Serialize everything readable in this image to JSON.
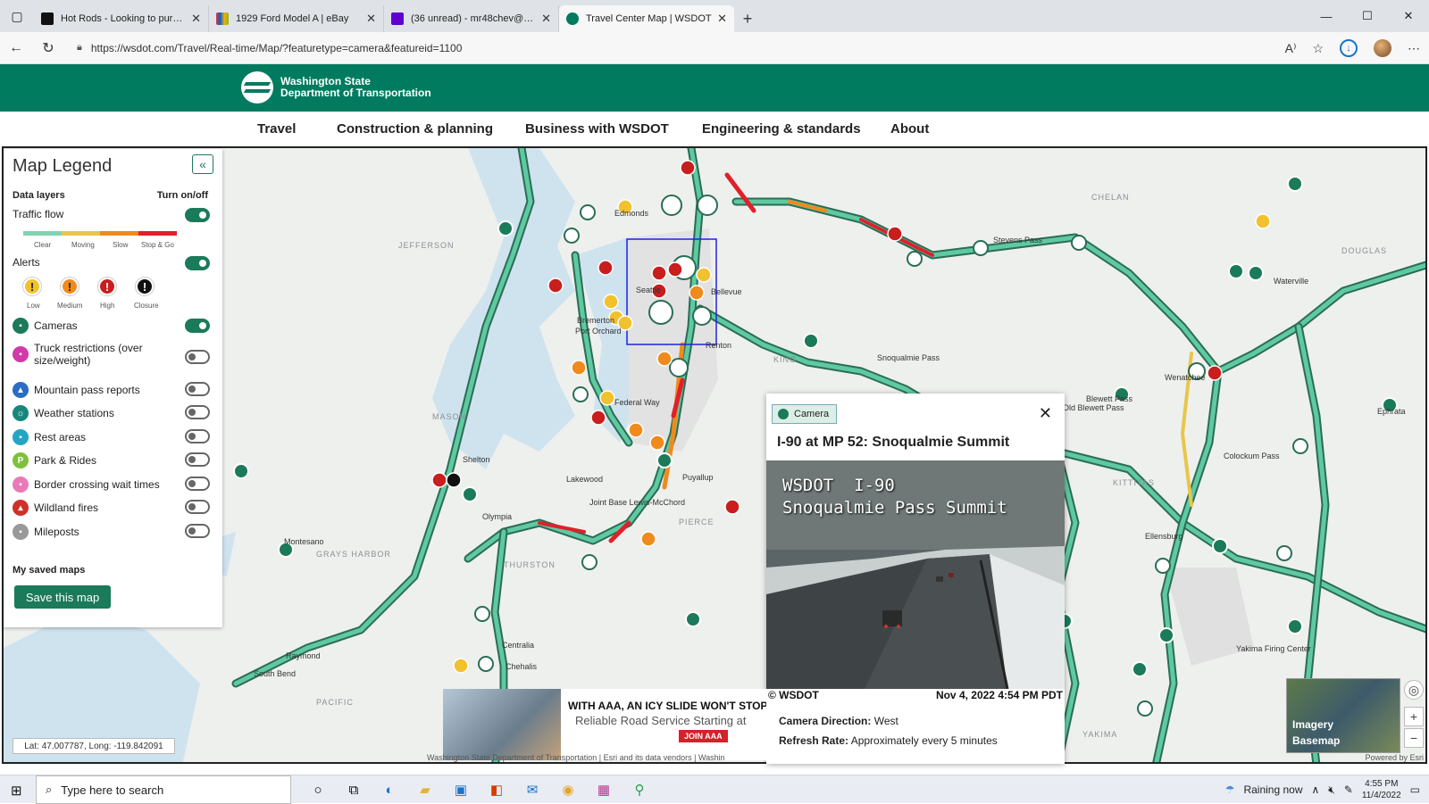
{
  "browser": {
    "tabs": [
      {
        "title": "Hot Rods - Looking to purchase",
        "color": "#111111"
      },
      {
        "title": "1929 Ford Model A | eBay",
        "color": "#e53238"
      },
      {
        "title": "(36 unread) - mr48chev@yahoo.c",
        "color": "#6001d2"
      },
      {
        "title": "Travel Center Map | WSDOT",
        "color": "#007b5f"
      }
    ],
    "url": "https://wsdot.com/Travel/Real-time/Map/?featuretype=camera&featureid=1100"
  },
  "site": {
    "logo_line1": "Washington State",
    "logo_line2": "Department of Transportation",
    "nav": [
      "Travel",
      "Construction & planning",
      "Business with WSDOT",
      "Engineering & standards",
      "About"
    ]
  },
  "legend": {
    "title": "Map Legend",
    "data_layers_label": "Data layers",
    "turn_label": "Turn on/off",
    "traffic_flow": "Traffic flow",
    "flow_labels": [
      "Clear",
      "Moving",
      "Slow",
      "Stop & Go"
    ],
    "alerts": "Alerts",
    "alert_levels": [
      "Low",
      "Medium",
      "High",
      "Closure"
    ],
    "layers": [
      {
        "label": "Cameras",
        "on": true,
        "color": "#1b7a5a",
        "icon": "camera-icon"
      },
      {
        "label": "Truck restrictions (over size/weight)",
        "on": false,
        "color": "#d23aa8",
        "icon": "truck-icon"
      },
      {
        "label": "Mountain pass reports",
        "on": false,
        "color": "#2b6cc4",
        "icon": "mountain-icon"
      },
      {
        "label": "Weather stations",
        "on": false,
        "color": "#16877a",
        "icon": "weather-icon"
      },
      {
        "label": "Rest areas",
        "on": false,
        "color": "#23a6c4",
        "icon": "rest-area-icon"
      },
      {
        "label": "Park & Rides",
        "on": false,
        "color": "#7cc23a",
        "icon": "park-ride-icon"
      },
      {
        "label": "Border crossing wait times",
        "on": false,
        "color": "#e87ab8",
        "icon": "border-icon"
      },
      {
        "label": "Wildland fires",
        "on": false,
        "color": "#d0302a",
        "icon": "fire-icon"
      },
      {
        "label": "Mileposts",
        "on": false,
        "color": "#999999",
        "icon": "milepost-icon"
      }
    ],
    "saved_maps": "My saved maps",
    "save_button": "Save this map"
  },
  "popup": {
    "badge": "Camera",
    "title": "I-90 at MP 52: Snoqualmie Summit",
    "caption_line1": "WSDOT  I-90",
    "caption_line2": "Snoqualmie Pass Summit",
    "footer_left": "© WSDOT",
    "footer_right": "Nov 4, 2022 4:54 PM PDT",
    "direction_label": "Camera Direction:",
    "direction_value": "West",
    "refresh_label": "Refresh Rate:",
    "refresh_value": "Approximately every 5 minutes"
  },
  "ad": {
    "headline": "WITH AAA, AN ICY SLIDE WON'T STOP Y",
    "subline": "Reliable Road Service Starting at",
    "button": "JOIN AAA"
  },
  "map": {
    "coords": "Lat: 47.007787, Long: -119.842091",
    "attribution": "Washington State Department of Transportation | Esri and its data vendors | Washin",
    "powered": "Powered by Esri",
    "basemap_line1": "Imagery",
    "basemap_line2": "Basemap",
    "regions": [
      "JEFFERSON",
      "CHELAN",
      "DOUGLAS",
      "KING",
      "MASON",
      "KITTITAS",
      "PIERCE",
      "THURSTON",
      "GRAYS HARBOR",
      "PACIFIC",
      "YAKIMA"
    ],
    "places": [
      "Edmonds",
      "Stevens Pass",
      "Waterville",
      "Wenatchee",
      "Snoqualmie Pass",
      "Blewett Pass",
      "Old Blewett Pass",
      "Colockum Pass",
      "Ellensburg",
      "Yakima Firing Center",
      "Shelton",
      "Lakewood",
      "Joint Base Lewis-McChord",
      "Puyallup",
      "Olympia",
      "Montesano",
      "Centralia",
      "Chehalis",
      "Raymond",
      "South Bend",
      "Ephrata",
      "Bremerton",
      "Port Orchard",
      "Federal Way",
      "Renton",
      "Bellevue",
      "Seattle"
    ]
  },
  "taskbar": {
    "search_placeholder": "Type here to search",
    "weather": "Raining now",
    "time": "4:55 PM",
    "date": "11/4/2022"
  }
}
